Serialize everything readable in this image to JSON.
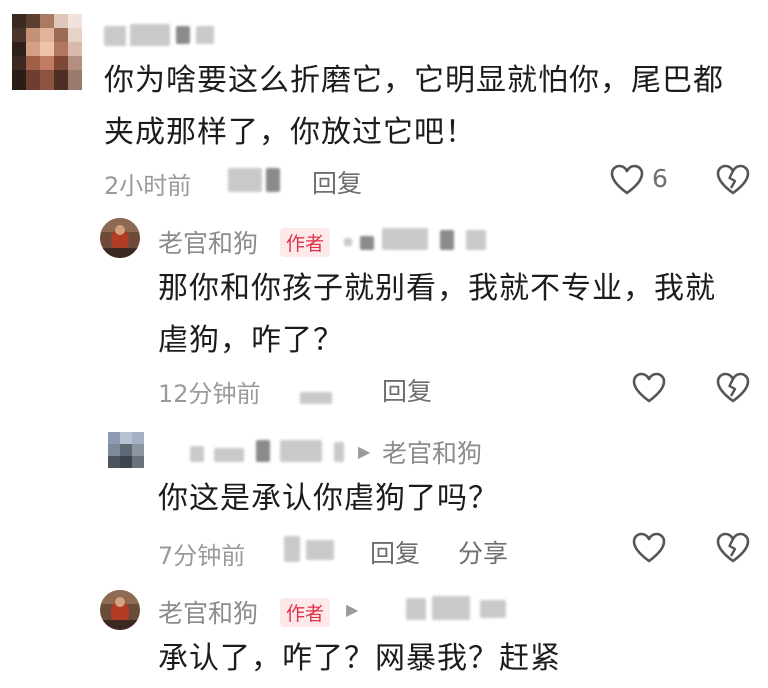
{
  "comments": [
    {
      "text_lines": [
        "你为啥要这么折磨它，它明显就怕你，尾巴都",
        "夹成那样了，你放过它吧！"
      ],
      "time": "2小时前",
      "reply_label": "回复",
      "like_count": "6"
    },
    {
      "author": "老官和狗",
      "badge": "作者",
      "text_lines": [
        "那你和你孩子就别看，我就不专业，我就",
        "虐狗，咋了？"
      ],
      "time": "12分钟前",
      "reply_label": "回复"
    },
    {
      "reply_to": "老官和狗",
      "text_lines": [
        "你这是承认你虐狗了吗？"
      ],
      "time": "7分钟前",
      "reply_label": "回复",
      "share_label": "分享"
    },
    {
      "author": "老官和狗",
      "badge": "作者",
      "text_lines": [
        "承认了，咋了？网暴我？赶紧"
      ]
    }
  ],
  "icons": {
    "like": "heart-outline-icon",
    "dislike": "broken-heart-icon",
    "reply_arrow": "triangle-right-icon"
  },
  "colors": {
    "author_badge_text": "#e0334a",
    "author_badge_bg": "#fde8ea",
    "meta_text": "#9a9a9a"
  }
}
